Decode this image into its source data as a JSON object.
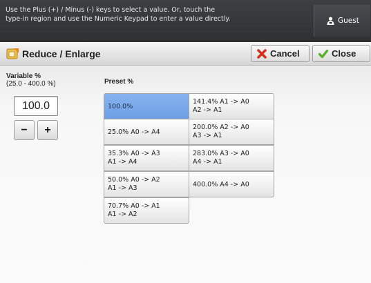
{
  "message": {
    "text": "Use the Plus (+) / Minus (-) keys to select a value.  Or, touch the\ntype-in region and use the Numeric Keypad to enter a value directly."
  },
  "user": {
    "label": "Guest",
    "icon": "user-icon"
  },
  "title": {
    "text": "Reduce / Enlarge",
    "icon": "reduce-enlarge-icon"
  },
  "buttons": {
    "cancel": {
      "label": "Cancel",
      "icon": "red-x-icon",
      "color": "#d32f1a"
    },
    "close": {
      "label": "Close",
      "icon": "green-check-icon",
      "color": "#58b02b"
    }
  },
  "variable": {
    "title": "Variable %",
    "range": "(25.0 - 400.0 %)",
    "value": "100.0",
    "minus_label": "−",
    "plus_label": "+"
  },
  "preset": {
    "title": "Preset %",
    "selected_color": "#7aa9eb",
    "items": [
      {
        "label": "100.0%",
        "selected": true
      },
      {
        "label": "141.4% A1 -> A0\nA2 -> A1",
        "selected": false
      },
      {
        "label": "25.0% A0 -> A4",
        "selected": false
      },
      {
        "label": "200.0% A2 -> A0\nA3 -> A1",
        "selected": false
      },
      {
        "label": "35.3% A0 -> A3\nA1 -> A4",
        "selected": false
      },
      {
        "label": "283.0% A3 -> A0\nA4 -> A1",
        "selected": false
      },
      {
        "label": "50.0% A0 -> A2\nA1 -> A3",
        "selected": false
      },
      {
        "label": "400.0% A4 -> A0",
        "selected": false
      },
      {
        "label": "70.7% A0 -> A1\nA1 -> A2",
        "selected": false
      }
    ]
  }
}
